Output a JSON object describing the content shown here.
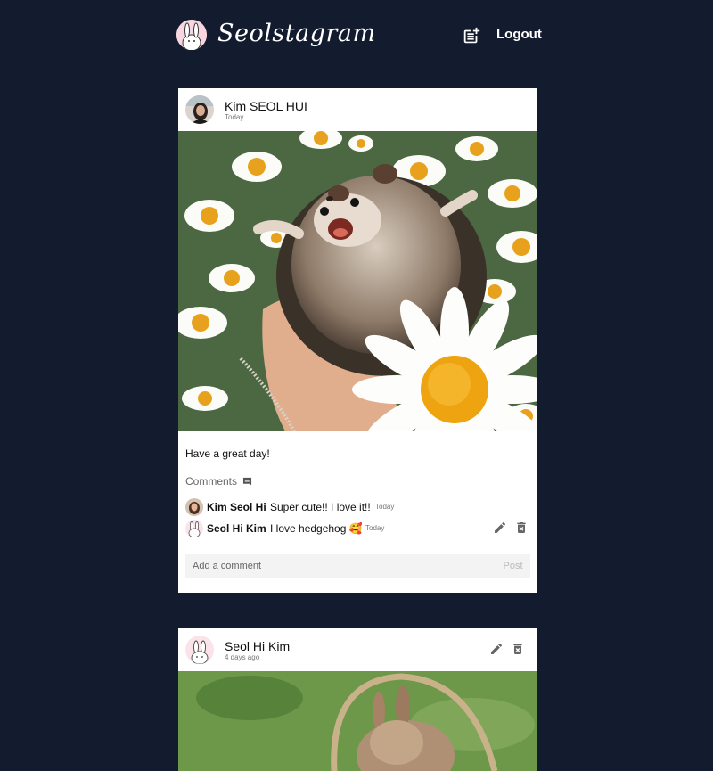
{
  "header": {
    "brand": "Seolstagram",
    "logout_label": "Logout",
    "new_post_icon": "post-add-icon",
    "logo_icon": "bunny-avatar-icon"
  },
  "posts": [
    {
      "author": "Kim SEOL HUI",
      "time": "Today",
      "photo_description_icon": "hedgehog-photo",
      "caption": "Have a great day!",
      "comments_label": "Comments",
      "comments": [
        {
          "author": "Kim Seol Hi",
          "text": "Super cute!! I love it!!",
          "time": "Today"
        },
        {
          "author": "Seol Hi Kim",
          "text": "I love hedgehog 🥰",
          "time": "Today"
        }
      ],
      "add_comment_placeholder": "Add a comment",
      "post_label": "Post"
    },
    {
      "author": "Seol Hi Kim",
      "time": "4 days ago",
      "photo_description_icon": "bunny-basket-photo"
    }
  ],
  "colors": {
    "background": "#131b2e",
    "card": "#ffffff",
    "icon": "#666666"
  }
}
